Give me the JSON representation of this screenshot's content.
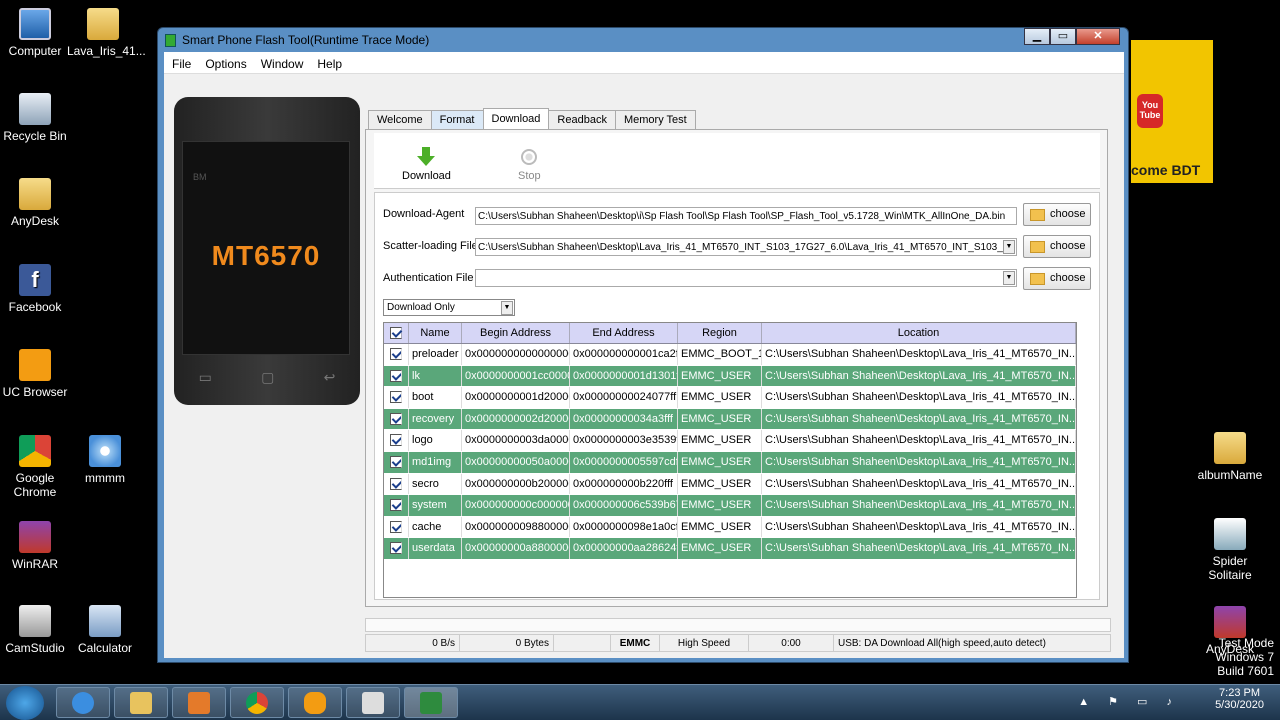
{
  "desktop": {
    "icons_left": [
      {
        "label": "Computer",
        "icon": "computer-icon"
      },
      {
        "label": "Lava_Iris_41...",
        "icon": "folder-icon"
      },
      {
        "label": "Recycle Bin",
        "icon": "recycle-bin-icon"
      },
      {
        "label": "AnyDesk",
        "icon": "folder-icon"
      },
      {
        "label": "Facebook",
        "icon": "facebook-icon"
      },
      {
        "label": "UC Browser",
        "icon": "uc-browser-icon"
      },
      {
        "label": "Google Chrome",
        "icon": "chrome-icon"
      },
      {
        "label": "mmmm",
        "icon": "cd-icon"
      },
      {
        "label": "WinRAR",
        "icon": "winrar-icon"
      },
      {
        "label": "CamStudio",
        "icon": "camstudio-icon"
      },
      {
        "label": "Calculator",
        "icon": "calculator-icon"
      }
    ],
    "icons_right": [
      {
        "label": "albumName",
        "icon": "folder-icon"
      },
      {
        "label": "Spider Solitaire",
        "icon": "spider-solitaire-icon"
      },
      {
        "label": "AnyDesk",
        "icon": "winrar-icon"
      }
    ],
    "yt_panel_text": "come BDT",
    "yt_logo": "You Tube",
    "watermark_line1": "Test Mode",
    "watermark_line2": "Windows 7",
    "watermark_line3": "Build 7601"
  },
  "window": {
    "title": "Smart Phone Flash Tool(Runtime Trace Mode)",
    "menu": [
      "File",
      "Options",
      "Window",
      "Help"
    ],
    "phone_model": "MT6570",
    "phone_brand": "BM",
    "tabs": [
      "Welcome",
      "Format",
      "Download",
      "Readback",
      "Memory Test"
    ],
    "toolbar": {
      "download": "Download",
      "stop": "Stop"
    },
    "fields": {
      "download_agent_label": "Download-Agent",
      "download_agent_value": "C:\\Users\\Subhan Shaheen\\Desktop\\i\\Sp Flash Tool\\Sp Flash Tool\\SP_Flash_Tool_v5.1728_Win\\MTK_AllInOne_DA.bin",
      "scatter_label": "Scatter-loading File",
      "scatter_value": "C:\\Users\\Subhan Shaheen\\Desktop\\Lava_Iris_41_MT6570_INT_S103_17G27_6.0\\Lava_Iris_41_MT6570_INT_S103_",
      "auth_label": "Authentication File",
      "auth_value": "",
      "choose": "choose"
    },
    "mode": "Download Only",
    "table": {
      "headers": [
        "Name",
        "Begin Address",
        "End Address",
        "Region",
        "Location"
      ],
      "rows": [
        {
          "name": "preloader",
          "begin": "0x0000000000000000",
          "end": "0x000000000001ca2f",
          "region": "EMMC_BOOT_1",
          "location": "C:\\Users\\Subhan Shaheen\\Desktop\\Lava_Iris_41_MT6570_IN..."
        },
        {
          "name": "lk",
          "begin": "0x0000000001cc0000",
          "end": "0x0000000001d1301f",
          "region": "EMMC_USER",
          "location": "C:\\Users\\Subhan Shaheen\\Desktop\\Lava_Iris_41_MT6570_IN..."
        },
        {
          "name": "boot",
          "begin": "0x0000000001d20000",
          "end": "0x00000000024077ff",
          "region": "EMMC_USER",
          "location": "C:\\Users\\Subhan Shaheen\\Desktop\\Lava_Iris_41_MT6570_IN..."
        },
        {
          "name": "recovery",
          "begin": "0x0000000002d20000",
          "end": "0x00000000034a3fff",
          "region": "EMMC_USER",
          "location": "C:\\Users\\Subhan Shaheen\\Desktop\\Lava_Iris_41_MT6570_IN..."
        },
        {
          "name": "logo",
          "begin": "0x0000000003da0000",
          "end": "0x0000000003e3539f",
          "region": "EMMC_USER",
          "location": "C:\\Users\\Subhan Shaheen\\Desktop\\Lava_Iris_41_MT6570_IN..."
        },
        {
          "name": "md1img",
          "begin": "0x00000000050a0000",
          "end": "0x0000000005597cdf",
          "region": "EMMC_USER",
          "location": "C:\\Users\\Subhan Shaheen\\Desktop\\Lava_Iris_41_MT6570_IN..."
        },
        {
          "name": "secro",
          "begin": "0x000000000b200000",
          "end": "0x000000000b220fff",
          "region": "EMMC_USER",
          "location": "C:\\Users\\Subhan Shaheen\\Desktop\\Lava_Iris_41_MT6570_IN..."
        },
        {
          "name": "system",
          "begin": "0x000000000c000000",
          "end": "0x000000006c539b67",
          "region": "EMMC_USER",
          "location": "C:\\Users\\Subhan Shaheen\\Desktop\\Lava_Iris_41_MT6570_IN..."
        },
        {
          "name": "cache",
          "begin": "0x0000000098800000",
          "end": "0x0000000098e1a0cf",
          "region": "EMMC_USER",
          "location": "C:\\Users\\Subhan Shaheen\\Desktop\\Lava_Iris_41_MT6570_IN..."
        },
        {
          "name": "userdata",
          "begin": "0x00000000a8800000",
          "end": "0x00000000aa28624f",
          "region": "EMMC_USER",
          "location": "C:\\Users\\Subhan Shaheen\\Desktop\\Lava_Iris_41_MT6570_IN..."
        }
      ]
    },
    "status": {
      "speed": "0 B/s",
      "bytes": "0 Bytes",
      "storage": "EMMC",
      "mode": "High Speed",
      "time": "0:00",
      "usb": "USB: DA Download All(high speed,auto detect)"
    }
  },
  "taskbar": {
    "time": "7:23 PM",
    "date": "5/30/2020"
  },
  "colors": {
    "row_green": "#5aa77a",
    "header_bg": "#d6d6f6",
    "window_frame": "#5a8fc4"
  }
}
